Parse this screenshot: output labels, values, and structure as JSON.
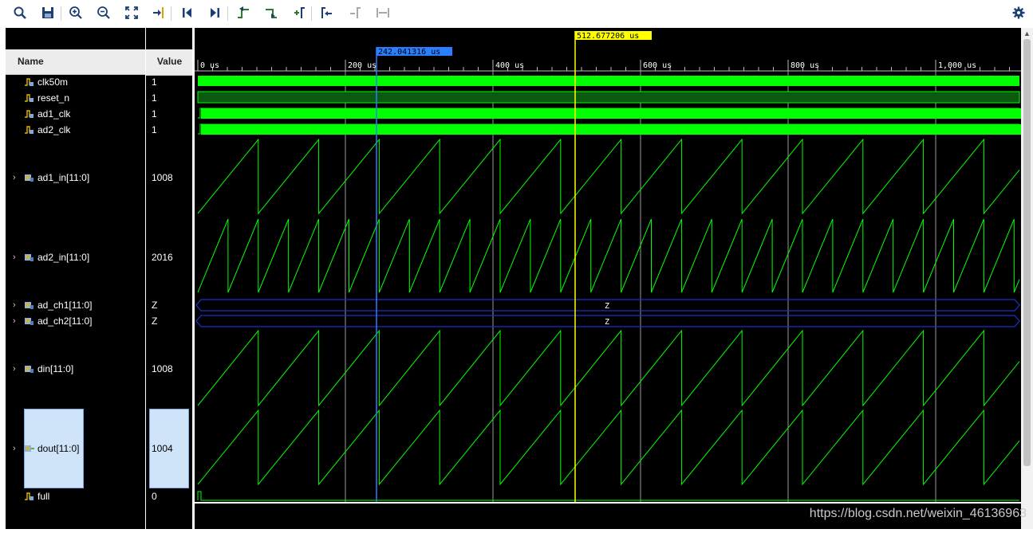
{
  "toolbar": {
    "buttons": [
      "search",
      "save",
      "zoom-in",
      "zoom-out",
      "zoom-fit",
      "go-to-cursor",
      "go-to-time-0",
      "go-to-last-time",
      "previous-transition",
      "next-transition",
      "add-marker",
      "previous-marker",
      "next-marker",
      "swap-cursors"
    ],
    "settings_icon": "gear-icon"
  },
  "headers": {
    "name": "Name",
    "value": "Value"
  },
  "signals": [
    {
      "name": "clk50m",
      "value": "1",
      "icon": "bit-icon",
      "expandable": false
    },
    {
      "name": "reset_n",
      "value": "1",
      "icon": "bit-icon",
      "expandable": false
    },
    {
      "name": "ad1_clk",
      "value": "1",
      "icon": "bit-icon",
      "expandable": false
    },
    {
      "name": "ad2_clk",
      "value": "1",
      "icon": "bit-icon",
      "expandable": false
    },
    {
      "name": "ad1_in[11:0]",
      "value": "1008",
      "icon": "bus-icon",
      "expandable": true
    },
    {
      "name": "ad2_in[11:0]",
      "value": "2016",
      "icon": "bus-icon",
      "expandable": true
    },
    {
      "name": "ad_ch1[11:0]",
      "value": "Z",
      "icon": "bus-icon",
      "expandable": true
    },
    {
      "name": "ad_ch2[11:0]",
      "value": "Z",
      "icon": "bus-icon",
      "expandable": true
    },
    {
      "name": "din[11:0]",
      "value": "1008",
      "icon": "bus-icon",
      "expandable": true
    },
    {
      "name": "dout[11:0]",
      "value": "1004",
      "icon": "bus-out-icon",
      "expandable": true
    },
    {
      "name": "full",
      "value": "0",
      "icon": "bit-icon",
      "expandable": false
    }
  ],
  "timeline": {
    "tick_labels": [
      "0 us",
      "200 us",
      "400 us",
      "600 us",
      "800 us",
      "1,000 us"
    ],
    "cursor_main": "512.677206 us",
    "cursor_second": "242.041316 us",
    "z_label": "Z"
  },
  "colors": {
    "background": "#000000",
    "waveform": "#00ff00",
    "bus_z": "#1d2fcf",
    "cursor_main": "#ffff00",
    "cursor_second": "#2a7fff",
    "selection": "#cfe3f9"
  },
  "watermark": "https://blog.csdn.net/weixin_46136963"
}
